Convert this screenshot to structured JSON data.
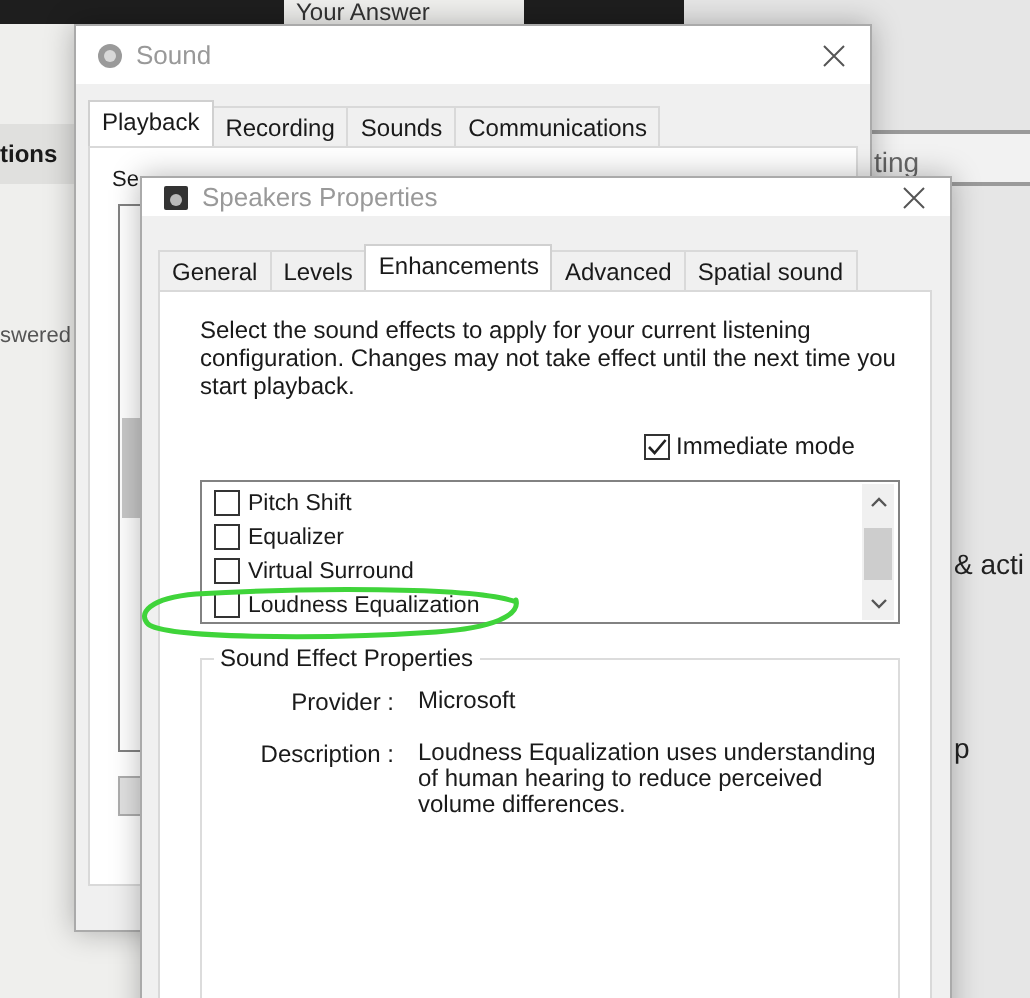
{
  "background_page": {
    "heading": "Your Answer",
    "left_texts": [
      {
        "text": "tions",
        "kind": "nav"
      },
      {
        "text": "swered",
        "kind": "note"
      }
    ],
    "search_text": "ting",
    "right_texts": [
      "& acti",
      "p"
    ]
  },
  "sound_window": {
    "title": "Sound",
    "tabs": [
      {
        "label": "Playback",
        "selected": true
      },
      {
        "label": "Recording",
        "selected": false
      },
      {
        "label": "Sounds",
        "selected": false
      },
      {
        "label": "Communications",
        "selected": false
      }
    ],
    "instruction": "Se"
  },
  "speakers_window": {
    "title": "Speakers Properties",
    "tabs": [
      {
        "label": "General",
        "selected": false
      },
      {
        "label": "Levels",
        "selected": false
      },
      {
        "label": "Enhancements",
        "selected": true
      },
      {
        "label": "Advanced",
        "selected": false
      },
      {
        "label": "Spatial sound",
        "selected": false
      }
    ],
    "intro": "Select the sound effects to apply for your current listening configuration. Changes may not take effect until the next time you start playback.",
    "immediate_mode": {
      "label": "Immediate mode",
      "checked": true
    },
    "effects": [
      {
        "label": "Pitch Shift",
        "checked": false
      },
      {
        "label": "Equalizer",
        "checked": false
      },
      {
        "label": "Virtual Surround",
        "checked": false
      },
      {
        "label": "Loudness Equalization",
        "checked": false
      }
    ],
    "properties": {
      "title": "Sound Effect Properties",
      "rows": [
        {
          "label": "Provider :",
          "value": "Microsoft"
        },
        {
          "label": "Description :",
          "value": "Loudness Equalization uses understanding of human hearing to reduce perceived volume differences."
        }
      ]
    }
  }
}
